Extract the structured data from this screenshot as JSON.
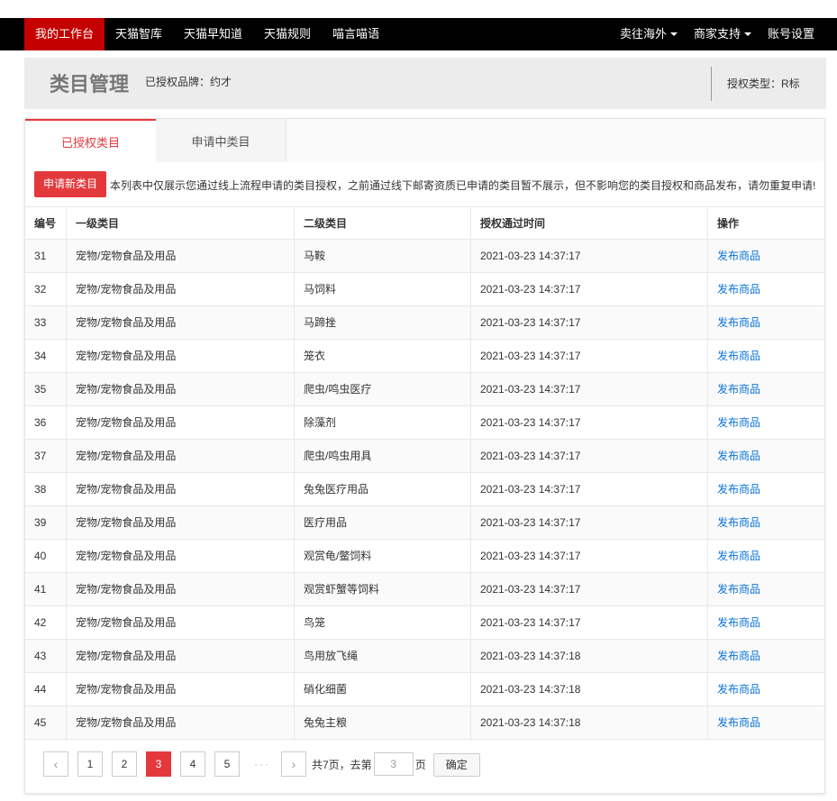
{
  "nav": {
    "left": [
      "我的工作台",
      "天猫智库",
      "天猫早知道",
      "天猫规则",
      "喵言喵语"
    ],
    "right": [
      {
        "label": "卖往海外",
        "dropdown": true
      },
      {
        "label": "商家支持",
        "dropdown": true
      },
      {
        "label": "账号设置",
        "dropdown": false
      }
    ]
  },
  "header": {
    "title": "类目管理",
    "brand": "已授权品牌：约才",
    "auth_type": "授权类型：R标"
  },
  "tabs": [
    "已授权类目",
    "申请中类目"
  ],
  "apply_button": "申请新类目",
  "notice": "本列表中仅展示您通过线上流程申请的类目授权，之前通过线下邮寄资质已申请的类目暂不展示，但不影响您的类目授权和商品发布，请勿重复申请!",
  "table": {
    "headers": [
      "编号",
      "一级类目",
      "二级类目",
      "授权通过时间",
      "操作"
    ],
    "action_label": "发布商品",
    "rows": [
      {
        "id": "31",
        "cat1": "宠物/宠物食品及用品",
        "cat2": "马鞍",
        "time": "2021-03-23 14:37:17"
      },
      {
        "id": "32",
        "cat1": "宠物/宠物食品及用品",
        "cat2": "马饲料",
        "time": "2021-03-23 14:37:17"
      },
      {
        "id": "33",
        "cat1": "宠物/宠物食品及用品",
        "cat2": "马蹄挫",
        "time": "2021-03-23 14:37:17"
      },
      {
        "id": "34",
        "cat1": "宠物/宠物食品及用品",
        "cat2": "笼衣",
        "time": "2021-03-23 14:37:17"
      },
      {
        "id": "35",
        "cat1": "宠物/宠物食品及用品",
        "cat2": "爬虫/鸣虫医疗",
        "time": "2021-03-23 14:37:17"
      },
      {
        "id": "36",
        "cat1": "宠物/宠物食品及用品",
        "cat2": "除藻剂",
        "time": "2021-03-23 14:37:17"
      },
      {
        "id": "37",
        "cat1": "宠物/宠物食品及用品",
        "cat2": "爬虫/鸣虫用具",
        "time": "2021-03-23 14:37:17"
      },
      {
        "id": "38",
        "cat1": "宠物/宠物食品及用品",
        "cat2": "兔兔医疗用品",
        "time": "2021-03-23 14:37:17"
      },
      {
        "id": "39",
        "cat1": "宠物/宠物食品及用品",
        "cat2": "医疗用品",
        "time": "2021-03-23 14:37:17"
      },
      {
        "id": "40",
        "cat1": "宠物/宠物食品及用品",
        "cat2": "观赏龟/鳖饲料",
        "time": "2021-03-23 14:37:17"
      },
      {
        "id": "41",
        "cat1": "宠物/宠物食品及用品",
        "cat2": "观赏虾蟹等饲料",
        "time": "2021-03-23 14:37:17"
      },
      {
        "id": "42",
        "cat1": "宠物/宠物食品及用品",
        "cat2": "鸟笼",
        "time": "2021-03-23 14:37:17"
      },
      {
        "id": "43",
        "cat1": "宠物/宠物食品及用品",
        "cat2": "鸟用放飞绳",
        "time": "2021-03-23 14:37:18"
      },
      {
        "id": "44",
        "cat1": "宠物/宠物食品及用品",
        "cat2": "硝化细菌",
        "time": "2021-03-23 14:37:18"
      },
      {
        "id": "45",
        "cat1": "宠物/宠物食品及用品",
        "cat2": "兔兔主粮",
        "time": "2021-03-23 14:37:18"
      }
    ]
  },
  "pagination": {
    "prev": "‹",
    "next": "›",
    "pages": [
      "1",
      "2",
      "3",
      "4",
      "5"
    ],
    "current": "3",
    "ellipsis": "···",
    "total_text": "共7页，去第",
    "input_value": "3",
    "suffix": "页",
    "confirm": "确定"
  }
}
